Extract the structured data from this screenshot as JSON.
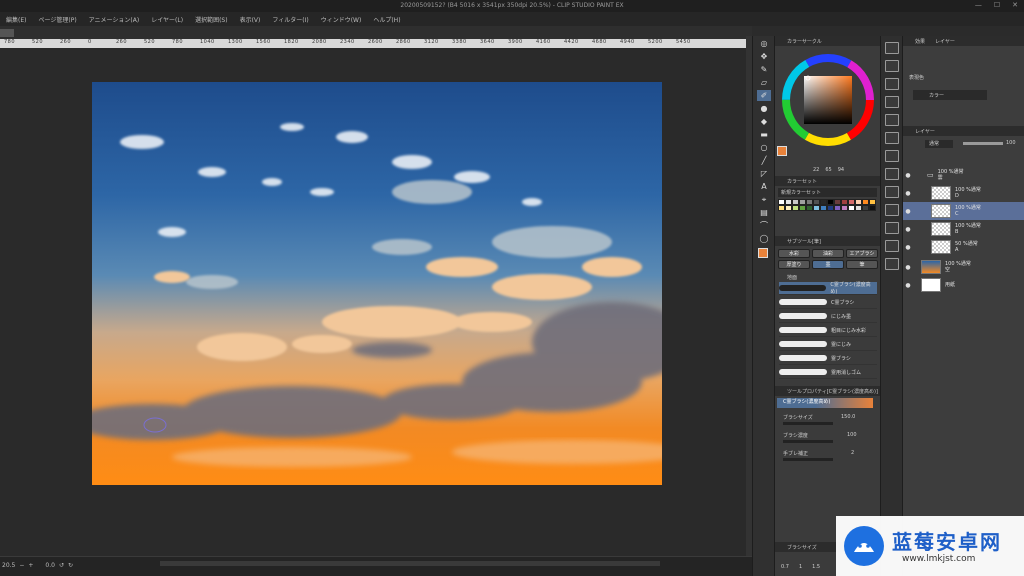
{
  "window": {
    "title": "20200509152? (B4 5016 x 3541px 350dpi 20.5%) - CLIP STUDIO PAINT EX",
    "controls": [
      "—",
      "☐",
      "✕"
    ]
  },
  "menu": [
    "編集(E)",
    "ページ管理(P)",
    "アニメーション(A)",
    "レイヤー(L)",
    "選択範囲(S)",
    "表示(V)",
    "フィルター(I)",
    "ウィンドウ(W)",
    "ヘルプ(H)"
  ],
  "ruler": {
    "numbers": [
      "780",
      "520",
      "260",
      "0",
      "260",
      "520",
      "780",
      "1040",
      "1300",
      "1560",
      "1820",
      "2080",
      "2340",
      "2600",
      "2860",
      "3120",
      "3380",
      "3640",
      "3900",
      "4160",
      "4420",
      "4680",
      "4940",
      "5200",
      "5450"
    ]
  },
  "status": {
    "zoom": "20.5",
    "angle": "0.0"
  },
  "color_wheel": {
    "panel_title": "カラーサークル",
    "readout": [
      "22",
      "65",
      "94"
    ],
    "current_color": "#e8823a"
  },
  "color_set": {
    "panel_title": "カラーセット",
    "set_name": "新規カラーセット",
    "swatches": [
      "#ffffff",
      "#e6e6e6",
      "#c8c8c8",
      "#a0a0a0",
      "#787878",
      "#505050",
      "#282828",
      "#000000",
      "#6a3c3c",
      "#a04040",
      "#d46a6a",
      "#ffd0b0",
      "#ff8a20",
      "#ffc040",
      "#ffe080",
      "#fff0c0",
      "#c0e080",
      "#60a040",
      "#306030",
      "#80c0e0",
      "#4080c0",
      "#203c80",
      "#8060c0",
      "#c080c0",
      "#ffffff",
      "#e0e0e0",
      "#404040",
      "#101010"
    ]
  },
  "subtool": {
    "panel_title": "サブツール[筆]",
    "tabs": [
      "水彩",
      "油彩",
      "エアブラシ",
      "厚塗り",
      "墨",
      "筆"
    ],
    "group": "地面",
    "brushes": [
      "C霊ブラシ(濃度高め)",
      "C霊ブラシ",
      "にじみ墨",
      "粗目にじみ水彩",
      "霊にじみ",
      "霊ブラシ",
      "霊用消しゴム"
    ]
  },
  "tool_property": {
    "panel_title": "ツールプロパティ[C霊ブラシ(濃度高め)]",
    "brush_name": "C霊ブラシ(濃度高め)",
    "rows": [
      {
        "label": "ブラシサイズ",
        "value": "150.0"
      },
      {
        "label": "ブラシ濃度",
        "value": "100"
      },
      {
        "label": "手ブレ補正",
        "value": "2"
      }
    ]
  },
  "brush_size_panel": {
    "panel_title": "ブラシサイズ",
    "sizes": [
      "0.7",
      "1",
      "1.5"
    ]
  },
  "effect_panel": {
    "tabs": [
      "効果",
      "レイヤー"
    ],
    "label": "表現色",
    "value": "カラー"
  },
  "layer_panel": {
    "panel_title": "レイヤー",
    "blend": "通常",
    "opacity": "100",
    "layers": [
      {
        "line1": "100 %通常",
        "line2": "雲",
        "kind": "folder"
      },
      {
        "line1": "100 %通常",
        "line2": "D",
        "kind": "layer"
      },
      {
        "line1": "100 %通常",
        "line2": "C",
        "kind": "layer",
        "selected": true
      },
      {
        "line1": "100 %通常",
        "line2": "B",
        "kind": "layer"
      },
      {
        "line1": "50 %通常",
        "line2": "A",
        "kind": "layer"
      },
      {
        "line1": "100 %通常",
        "line2": "空",
        "kind": "sky"
      },
      {
        "line1": "",
        "line2": "用紙",
        "kind": "paper"
      }
    ]
  },
  "watermark": {
    "cn": "蓝莓安卓网",
    "url": "www.lmkjst.com"
  },
  "icons": [
    "brush-icon",
    "pen-icon",
    "eraser-icon",
    "fill-icon",
    "text-icon",
    "gradient-icon",
    "shape-icon",
    "eyedropper-icon",
    "move-icon",
    "lasso-icon",
    "eye-icon",
    "folder-icon"
  ]
}
